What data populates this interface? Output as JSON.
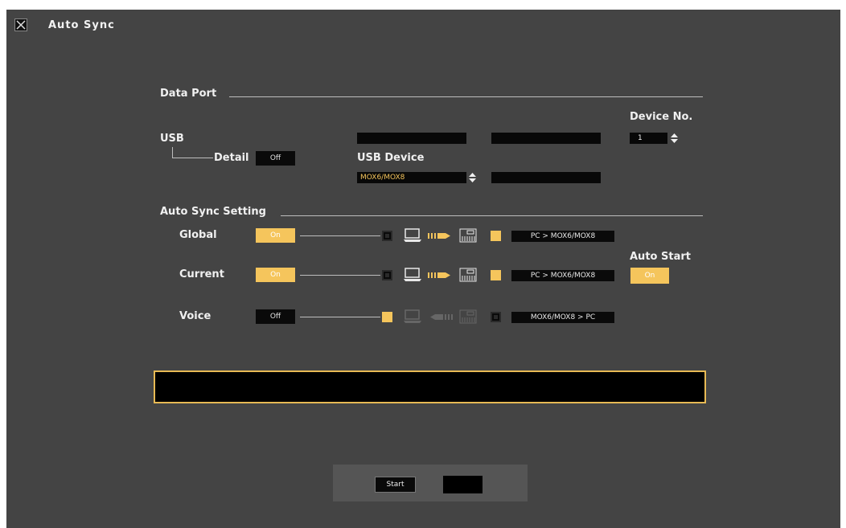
{
  "window": {
    "title": "Auto Sync"
  },
  "data_port": {
    "section_label": "Data Port",
    "usb_label": "USB",
    "detail_label": "Detail",
    "detail_value": "Off",
    "usb_device_label": "USB Device",
    "usb_device_value": "MOX6/MOX8",
    "device_no_label": "Device No.",
    "device_no_value": "1"
  },
  "auto_sync_setting": {
    "section_label": "Auto Sync Setting",
    "rows": [
      {
        "label": "Global",
        "state": "On",
        "pc_checked": false,
        "synth_checked": true,
        "direction": "PC > MOX6/MOX8"
      },
      {
        "label": "Current",
        "state": "On",
        "pc_checked": false,
        "synth_checked": true,
        "direction": "PC > MOX6/MOX8"
      },
      {
        "label": "Voice",
        "state": "Off",
        "pc_checked": true,
        "synth_checked": false,
        "direction": "MOX6/MOX8 > PC"
      }
    ],
    "auto_start_label": "Auto Start",
    "auto_start_value": "On"
  },
  "footer": {
    "start_label": "Start"
  },
  "colors": {
    "accent": "#f5c55c",
    "background": "#444444"
  }
}
